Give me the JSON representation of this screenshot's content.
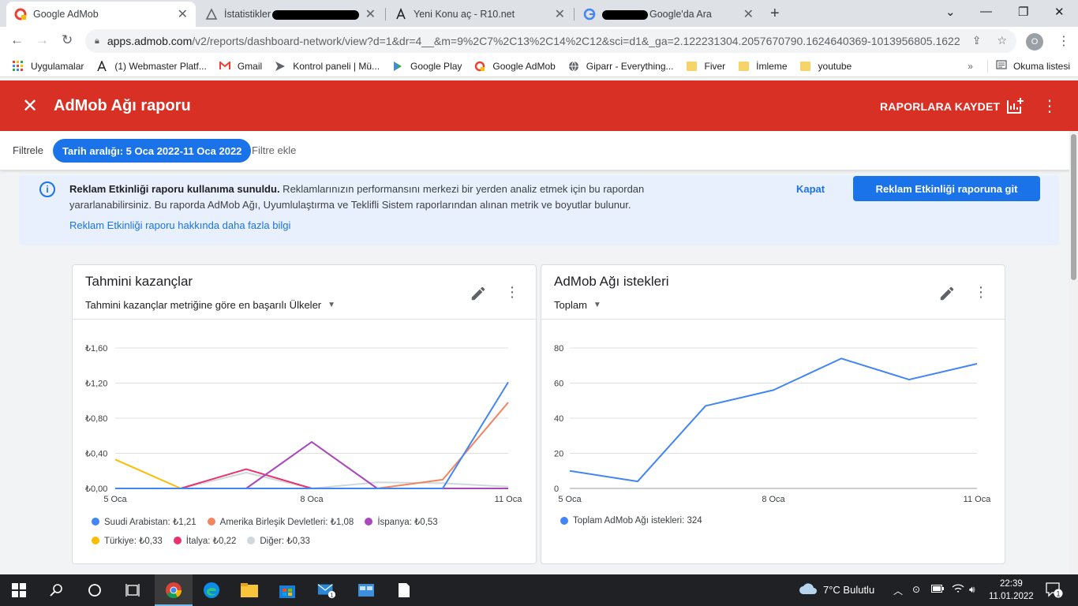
{
  "browser": {
    "tabs": [
      {
        "title": "Google AdMob",
        "active": true,
        "icon": "admob-logo-icon"
      },
      {
        "title": "İstatistikler",
        "active": false,
        "icon": "chart-favicon-icon",
        "redacted": true
      },
      {
        "title": "Yeni Konu aç - R10.net",
        "active": false,
        "icon": "r10-favicon-icon"
      },
      {
        "title": "Google'da Ara",
        "active": false,
        "icon": "google-favicon-icon",
        "redacted": true
      }
    ],
    "url_host": "apps.admob.com",
    "url_path": "/v2/reports/dashboard-network/view?d=1&dr=4__&m=9%2C7%2C13%2C14%2C12&sci=d1&_ga=2.122231304.2057670790.1624640369-1013956805.1622...",
    "profile_initial": "O",
    "bookmarks": [
      {
        "label": "Uygulamalar",
        "icon": "apps-grid-icon"
      },
      {
        "label": "(1) Webmaster Platf...",
        "icon": "webmaster-icon"
      },
      {
        "label": "Gmail",
        "icon": "gmail-icon"
      },
      {
        "label": "Kontrol paneli | Mü...",
        "icon": "panel-icon"
      },
      {
        "label": "Google Play",
        "icon": "google-play-icon"
      },
      {
        "label": "Google AdMob",
        "icon": "admob-icon"
      },
      {
        "label": "Giparr - Everything...",
        "icon": "globe-icon"
      },
      {
        "label": "Fiver",
        "icon": "folder-icon"
      },
      {
        "label": "İmleme",
        "icon": "folder-icon"
      },
      {
        "label": "youtube",
        "icon": "folder-icon"
      }
    ],
    "reading_list": "Okuma listesi"
  },
  "header": {
    "title": "AdMob Ağı raporu",
    "save_label": "RAPORLARA KAYDET"
  },
  "filters": {
    "label": "Filtrele",
    "date_chip": "Tarih aralığı: 5 Oca 2022-11 Oca 2022",
    "add_filter": "Filtre ekle"
  },
  "banner": {
    "bold": "Reklam Etkinliği raporu kullanıma sunuldu.",
    "text": " Reklamlarınızın performansını merkezi bir yerden analiz etmek için bu rapordan yararlanabilirsiniz. Bu raporda AdMob Ağı, Uyumlulaştırma ve Teklifli Sistem raporlarından alınan metrik ve boyutlar bulunur.",
    "learn_more": "Reklam Etkinliği raporu hakkında daha fazla bilgi",
    "dismiss": "Kapat",
    "cta": "Reklam Etkinliği raporuna git"
  },
  "cards": {
    "earnings": {
      "title": "Tahmini kazançlar",
      "subtitle": "Tahmini kazançlar metriğine göre en başarılı Ülkeler"
    },
    "requests": {
      "title": "AdMob Ağı istekleri",
      "subtitle": "Toplam"
    }
  },
  "chart_data": [
    {
      "type": "line",
      "title": "Tahmini kazançlar",
      "x": [
        "5 Oca",
        "6 Oca",
        "7 Oca",
        "8 Oca",
        "9 Oca",
        "10 Oca",
        "11 Oca"
      ],
      "x_tick_labels": [
        "5 Oca",
        "8 Oca",
        "11 Oca"
      ],
      "y_tick_labels": [
        "₺0,00",
        "₺0,40",
        "₺0,80",
        "₺1,20",
        "₺1,60"
      ],
      "ylim": [
        0,
        1.6
      ],
      "grid": true,
      "legend_position": "bottom",
      "series": [
        {
          "name": "Suudi Arabistan",
          "total": "₺1,21",
          "color": "#4285f4",
          "values": [
            0,
            0,
            0,
            0,
            0,
            0,
            1.21
          ]
        },
        {
          "name": "Amerika Birleşik Devletleri",
          "total": "₺1,08",
          "color": "#f4845f",
          "values": [
            0,
            0,
            0,
            0,
            0,
            0.1,
            0.98
          ]
        },
        {
          "name": "İspanya",
          "total": "₺0,53",
          "color": "#ab47bc",
          "values": [
            0,
            0,
            0,
            0.53,
            0,
            0,
            0
          ]
        },
        {
          "name": "Türkiye",
          "total": "₺0,33",
          "color": "#fbbc04",
          "values": [
            0.33,
            0,
            0,
            0,
            0,
            0,
            0
          ]
        },
        {
          "name": "İtalya",
          "total": "₺0,22",
          "color": "#e8336d",
          "values": [
            0,
            0,
            0.22,
            0,
            0,
            0,
            0
          ]
        },
        {
          "name": "Diğer",
          "total": "₺0,33",
          "color": "#cfd8dc",
          "values": [
            0,
            0,
            0.18,
            0,
            0.07,
            0.06,
            0.02
          ]
        }
      ]
    },
    {
      "type": "line",
      "title": "AdMob Ağı istekleri",
      "x": [
        "5 Oca",
        "6 Oca",
        "7 Oca",
        "8 Oca",
        "9 Oca",
        "10 Oca",
        "11 Oca"
      ],
      "x_tick_labels": [
        "5 Oca",
        "8 Oca",
        "11 Oca"
      ],
      "y_tick_labels": [
        "0",
        "20",
        "40",
        "60",
        "80"
      ],
      "ylim": [
        0,
        80
      ],
      "grid": true,
      "legend_position": "bottom",
      "series": [
        {
          "name": "Toplam AdMob Ağı istekleri",
          "total": "324",
          "color": "#4285f4",
          "values": [
            10,
            4,
            47,
            56,
            74,
            62,
            71
          ]
        }
      ]
    }
  ],
  "taskbar": {
    "weather": "7°C  Bulutlu",
    "time": "22:39",
    "date": "11.01.2022",
    "notifications": "1"
  }
}
